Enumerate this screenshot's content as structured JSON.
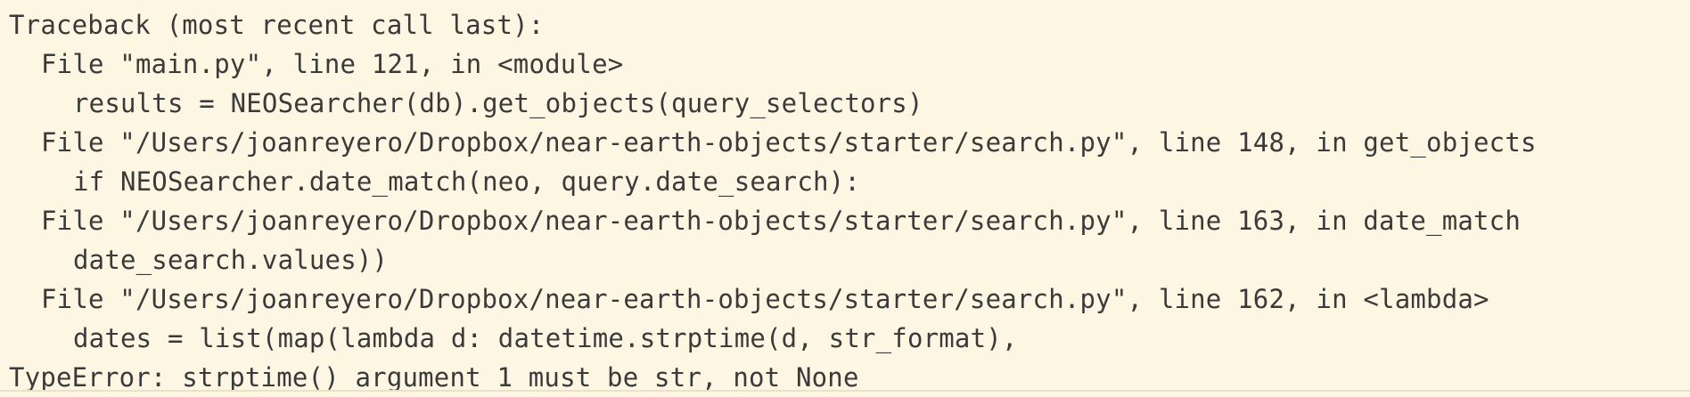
{
  "traceback": {
    "header": "Traceback (most recent call last):",
    "frames": [
      {
        "location": "File \"main.py\", line 121, in <module>",
        "code": "results = NEOSearcher(db).get_objects(query_selectors)"
      },
      {
        "location": "File \"/Users/joanreyero/Dropbox/near-earth-objects/starter/search.py\", line 148, in get_objects",
        "code": "if NEOSearcher.date_match(neo, query.date_search):"
      },
      {
        "location": "File \"/Users/joanreyero/Dropbox/near-earth-objects/starter/search.py\", line 163, in date_match",
        "code": "date_search.values))"
      },
      {
        "location": "File \"/Users/joanreyero/Dropbox/near-earth-objects/starter/search.py\", line 162, in <lambda>",
        "code": "dates = list(map(lambda d: datetime.strptime(d, str_format),"
      }
    ],
    "error": "TypeError: strptime() argument 1 must be str, not None"
  }
}
